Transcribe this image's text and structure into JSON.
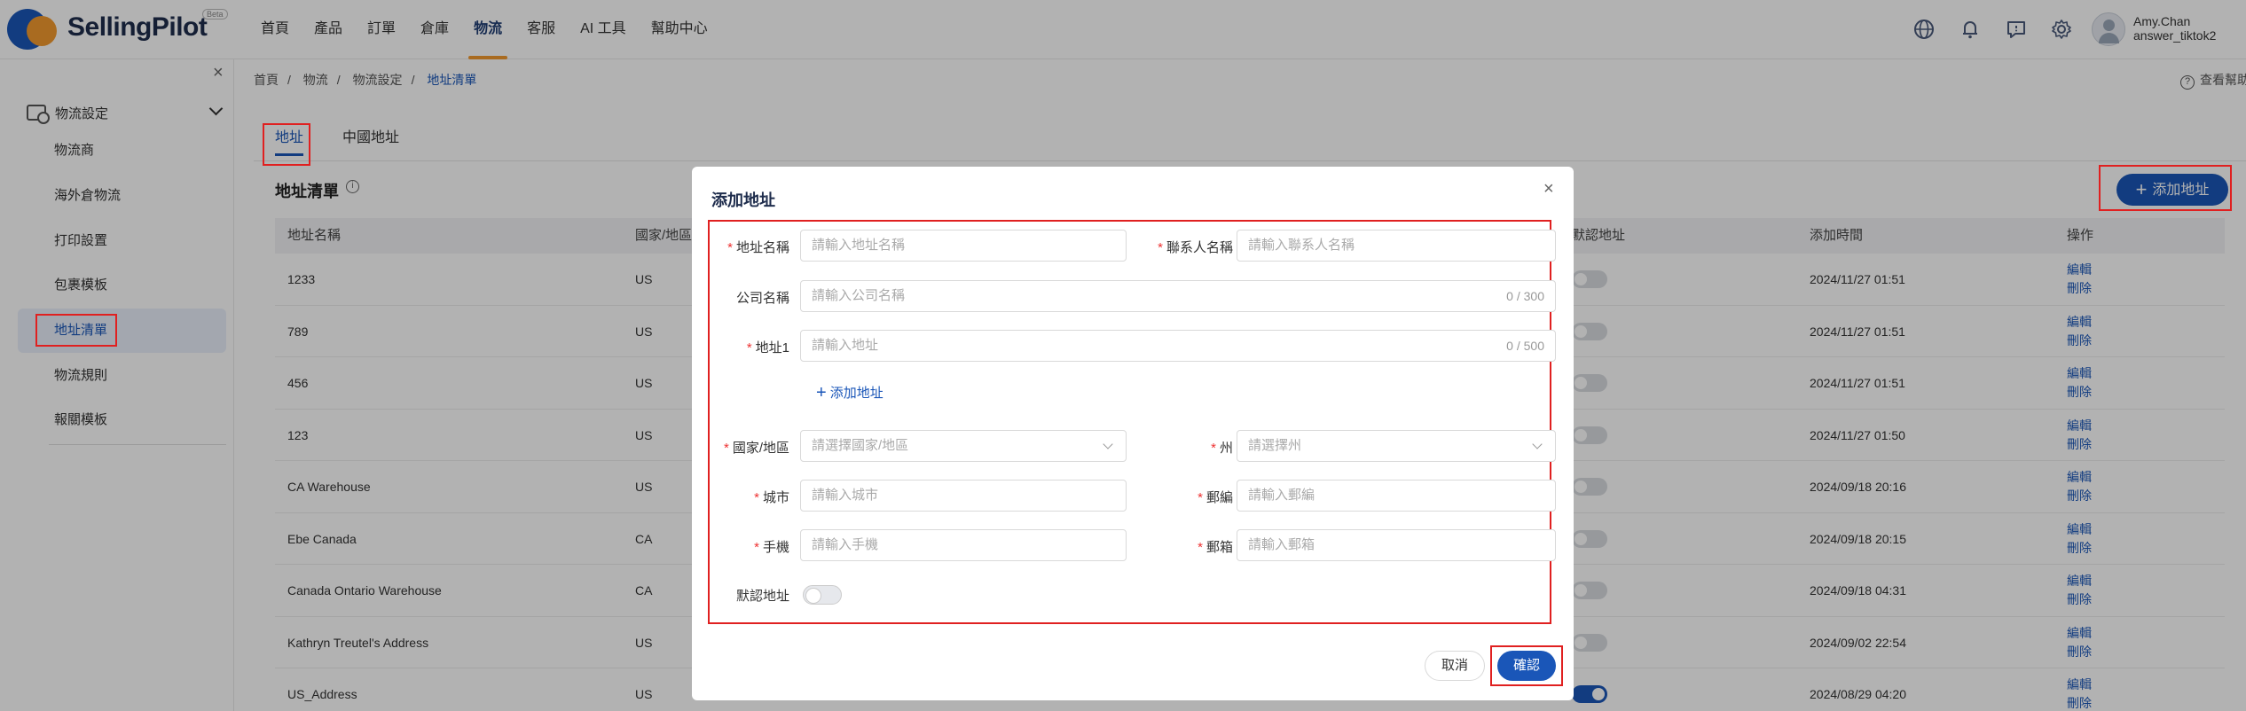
{
  "header": {
    "brand": "SellingPilot",
    "beta": "Beta",
    "nav": [
      "首頁",
      "產品",
      "訂單",
      "倉庫",
      "物流",
      "客服",
      "AI 工具",
      "幫助中心"
    ],
    "active_nav": "物流",
    "user_name": "Amy.Chan",
    "user_shop": "answer_tiktok2"
  },
  "sidebar": {
    "group": "物流設定",
    "items": [
      "物流商",
      "海外倉物流",
      "打印設置",
      "包裹模板",
      "地址清單",
      "物流規則",
      "報關模板"
    ],
    "active": "地址清單"
  },
  "breadcrumb": [
    "首頁",
    "物流",
    "物流設定",
    "地址清單"
  ],
  "help_text": "查看幫助",
  "tabs": [
    "地址",
    "中國地址"
  ],
  "list": {
    "title": "地址清單",
    "add_button": "添加地址",
    "columns": [
      "地址名稱",
      "國家/地區",
      "默認地址",
      "添加時間",
      "操作"
    ],
    "rows": [
      {
        "name": "1233",
        "country": "US",
        "time": "2024/11/27 01:51",
        "default": false
      },
      {
        "name": "789",
        "country": "US",
        "time": "2024/11/27 01:51",
        "default": false
      },
      {
        "name": "456",
        "country": "US",
        "time": "2024/11/27 01:51",
        "default": false
      },
      {
        "name": "123",
        "country": "US",
        "time": "2024/11/27 01:50",
        "default": false
      },
      {
        "name": "CA Warehouse",
        "country": "US",
        "time": "2024/09/18 20:16",
        "default": false
      },
      {
        "name": "Ebe Canada",
        "country": "CA",
        "time": "2024/09/18 20:15",
        "default": false
      },
      {
        "name": "Canada Ontario Warehouse",
        "country": "CA",
        "time": "2024/09/18 04:31",
        "default": false
      },
      {
        "name": "Kathryn Treutel's Address",
        "country": "US",
        "time": "2024/09/02 22:54",
        "default": false
      },
      {
        "name": "US_Address",
        "country": "US",
        "time": "2024/08/29 04:20",
        "default": true
      }
    ],
    "edit_label": "編輯",
    "delete_label": "刪除"
  },
  "modal": {
    "title": "添加地址",
    "fields": {
      "address_name": {
        "label": "地址名稱",
        "placeholder": "請輸入地址名稱"
      },
      "contact_name": {
        "label": "聯系人名稱",
        "placeholder": "請輸入聯系人名稱"
      },
      "company": {
        "label": "公司名稱",
        "placeholder": "請輸入公司名稱",
        "counter": "0 / 300"
      },
      "address1": {
        "label": "地址1",
        "placeholder": "請輸入地址",
        "counter": "0 / 500"
      },
      "country": {
        "label": "國家/地區",
        "placeholder": "請選擇國家/地區"
      },
      "state": {
        "label": "州",
        "placeholder": "請選擇州"
      },
      "city": {
        "label": "城市",
        "placeholder": "請輸入城市"
      },
      "zip": {
        "label": "郵編",
        "placeholder": "請輸入郵編"
      },
      "phone": {
        "label": "手機",
        "placeholder": "請輸入手機"
      },
      "email": {
        "label": "郵箱",
        "placeholder": "請輸入郵箱"
      },
      "default": {
        "label": "默認地址"
      }
    },
    "add_address_link": "添加地址",
    "cancel": "取消",
    "confirm": "確認"
  },
  "colors": {
    "primary": "#1a56b8",
    "accent": "#f29a2e",
    "highlight": "#e02020"
  }
}
